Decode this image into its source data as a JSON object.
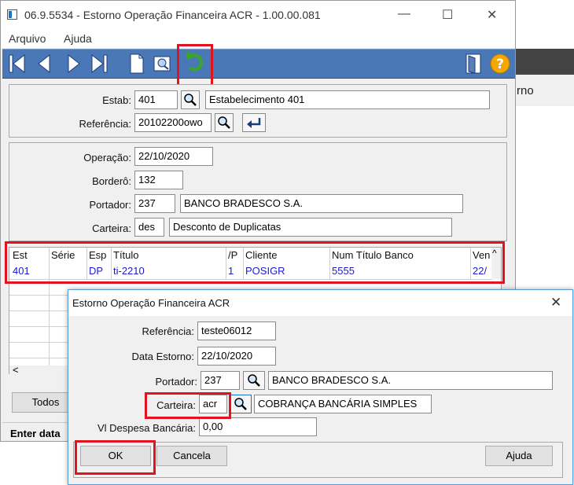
{
  "background_app": {
    "text": "rno"
  },
  "window": {
    "title": "06.9.5534 - Estorno Operação Financeira ACR - 1.00.00.081",
    "controls": {
      "minimize": "—",
      "maximize": "☐",
      "close": "✕"
    }
  },
  "menu": {
    "items": [
      "Arquivo",
      "Ajuda"
    ]
  },
  "colors": {
    "toolbar": "#4a78b7",
    "link": "#1a1acc",
    "highlight": "#e0141e",
    "help_icon": "#f5a800"
  },
  "header_form": {
    "estab_label": "Estab:",
    "estab_value": "401",
    "estab_desc": "Estabelecimento 401",
    "referencia_label": "Referência:",
    "referencia_value": "20102200owo"
  },
  "detail_form": {
    "operacao_label": "Operação:",
    "operacao_value": "22/10/2020",
    "bordero_label": "Borderô:",
    "bordero_value": "132",
    "portador_label": "Portador:",
    "portador_value": "237",
    "portador_desc": "BANCO BRADESCO S.A.",
    "carteira_label": "Carteira:",
    "carteira_value": "des",
    "carteira_desc": "Desconto de Duplicatas"
  },
  "grid": {
    "headers": [
      "Est",
      "Série",
      "Esp",
      "Título",
      "/P",
      "Cliente",
      "Num Título Banco",
      "Ven"
    ],
    "row": [
      "401",
      "",
      "DP",
      "ti-2210",
      "1",
      "POSIGR",
      "5555",
      "22/"
    ],
    "scroll_left": "<",
    "scroll_up": "^"
  },
  "main_buttons": {
    "todos": "Todos"
  },
  "status_text": "Enter data",
  "dialog": {
    "title": "Estorno Operação Financeira ACR",
    "close": "✕",
    "referencia_label": "Referência:",
    "referencia_value": "teste06012",
    "data_estorno_label": "Data Estorno:",
    "data_estorno_value": "22/10/2020",
    "portador_label": "Portador:",
    "portador_value": "237",
    "portador_desc": "BANCO BRADESCO S.A.",
    "carteira_label": "Carteira:",
    "carteira_value": "acr",
    "carteira_desc": "COBRANÇA BANCÁRIA SIMPLES",
    "despesa_label": "Vl Despesa Bancária:",
    "despesa_value": "0,00",
    "ok_label": "OK",
    "cancela_label": "Cancela",
    "ajuda_label": "Ajuda"
  }
}
